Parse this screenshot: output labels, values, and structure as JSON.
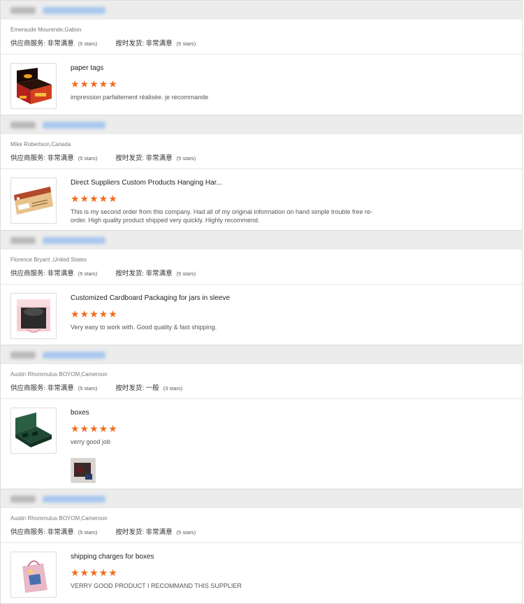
{
  "labels": {
    "supplier_service": "供应商服务:",
    "on_time_delivery": "按时发货:"
  },
  "colors": {
    "star": "#f26b1d",
    "header_bg": "#ececec"
  },
  "reviews": [
    {
      "buyer": "Emeraude Mourende,Gabon",
      "service_value": "非常满意",
      "service_stars": "(5 stars)",
      "delivery_value": "非常满意",
      "delivery_stars": "(5 stars)",
      "product_title": "paper tags",
      "rating": 5,
      "stars_text": "★★★★★",
      "comment": "impression parfaitement réalisée. je recommande",
      "thumbnail_icon": "red-gift-box-icon"
    },
    {
      "buyer": "Mike Robertson,Canada",
      "service_value": "非常满意",
      "service_stars": "(5 stars)",
      "delivery_value": "非常满意",
      "delivery_stars": "(5 stars)",
      "product_title": "Direct Suppliers Custom Products Hanging Har...",
      "rating": 5,
      "stars_text": "★★★★★",
      "comment": "This is my second order from this company. Had all of my original information on hand simple trouble free re-order. High quality product shipped very quickly. Highly recommend.",
      "thumbnail_icon": "hang-tag-icon"
    },
    {
      "buyer": "Florence Bryant ,United States",
      "service_value": "非常满意",
      "service_stars": "(5 stars)",
      "delivery_value": "非常满意",
      "delivery_stars": "(5 stars)",
      "product_title": "Customized Cardboard Packaging for jars in sleeve",
      "rating": 5,
      "stars_text": "★★★★★",
      "comment": "Very easy to work with.  Good quality & fast shipping.",
      "thumbnail_icon": "pink-box-icon"
    },
    {
      "buyer": "Austin Rhommulus BOYOM,Cameroon",
      "service_value": "非常满意",
      "service_stars": "(5 stars)",
      "delivery_value": "一般",
      "delivery_stars": "(3 stars)",
      "product_title": "boxes",
      "rating": 5,
      "stars_text": "★★★★★",
      "comment": "verry good job",
      "thumbnail_icon": "green-box-icon",
      "attachment_icon": "photo-attachment-icon"
    },
    {
      "buyer": "Austin Rhommulus BOYOM,Cameroon",
      "service_value": "非常满意",
      "service_stars": "(5 stars)",
      "delivery_value": "非常满意",
      "delivery_stars": "(5 stars)",
      "product_title": "shipping charges for boxes",
      "rating": 5,
      "stars_text": "★★★★★",
      "comment": "VERRY GOOD PRODUCT I RECOMMAND THIS SUPPLIER",
      "thumbnail_icon": "handle-bag-icon"
    }
  ]
}
